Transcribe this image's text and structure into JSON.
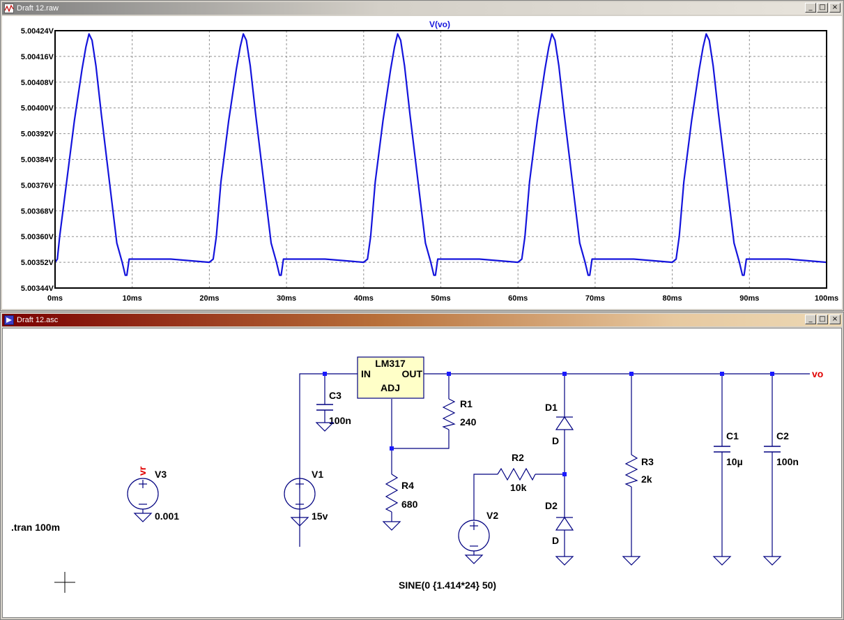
{
  "waveform_window": {
    "title": "Draft 12.raw",
    "buttons": {
      "minimize": "_",
      "maximize": "□",
      "close": "×"
    }
  },
  "schematic_window": {
    "title": "Draft 12.asc",
    "buttons": {
      "minimize": "_",
      "maximize": "□",
      "close": "×"
    }
  },
  "chart_data": {
    "type": "line",
    "title": "V(vo)",
    "xlabel": "",
    "ylabel": "",
    "xlim": [
      0,
      100
    ],
    "ylim": [
      5.00344,
      5.00424
    ],
    "x_ticks": [
      "0ms",
      "10ms",
      "20ms",
      "30ms",
      "40ms",
      "50ms",
      "60ms",
      "70ms",
      "80ms",
      "90ms",
      "100ms"
    ],
    "y_ticks": [
      "5.00424V",
      "5.00416V",
      "5.00408V",
      "5.00400V",
      "5.00392V",
      "5.00384V",
      "5.00376V",
      "5.00368V",
      "5.00360V",
      "5.00352V",
      "5.00344V"
    ],
    "grid": true,
    "series": [
      {
        "name": "V(vo)",
        "color": "#1414dc",
        "x": [
          0,
          0.3,
          0.6,
          1.5,
          2.5,
          3.5,
          4.0,
          4.4,
          4.8,
          5.3,
          6.0,
          7.0,
          8.0,
          8.7,
          9.1,
          9.3,
          9.6,
          10.5,
          15,
          20.0,
          20.5,
          20.9,
          21.5,
          22.5,
          23.5,
          24.0,
          24.4,
          24.8,
          25.3,
          26.0,
          27.0,
          28.0,
          28.7,
          29.1,
          29.3,
          29.6,
          30.5,
          35,
          40.0,
          40.5,
          40.9,
          41.5,
          42.5,
          43.5,
          44.0,
          44.4,
          44.8,
          45.3,
          46.0,
          47.0,
          48.0,
          48.7,
          49.1,
          49.3,
          49.6,
          50.5,
          55,
          60.0,
          60.5,
          60.9,
          61.5,
          62.5,
          63.5,
          64.0,
          64.4,
          64.8,
          65.3,
          66.0,
          67.0,
          68.0,
          68.7,
          69.1,
          69.3,
          69.6,
          70.5,
          75,
          80.0,
          80.5,
          80.9,
          81.5,
          82.5,
          83.5,
          84.0,
          84.4,
          84.8,
          85.3,
          86.0,
          87.0,
          88.0,
          88.7,
          89.1,
          89.3,
          89.6,
          90.5,
          95,
          100
        ],
        "values": [
          5.00352,
          5.00353,
          5.0036,
          5.00377,
          5.00396,
          5.00412,
          5.00419,
          5.00423,
          5.00421,
          5.00413,
          5.00398,
          5.00378,
          5.00358,
          5.00352,
          5.00348,
          5.00348,
          5.00353,
          5.00353,
          5.00353,
          5.00352,
          5.00353,
          5.0036,
          5.00377,
          5.00396,
          5.00412,
          5.00419,
          5.00423,
          5.00421,
          5.00413,
          5.00398,
          5.00378,
          5.00358,
          5.00352,
          5.00348,
          5.00348,
          5.00353,
          5.00353,
          5.00353,
          5.00352,
          5.00353,
          5.0036,
          5.00377,
          5.00396,
          5.00412,
          5.00419,
          5.00423,
          5.00421,
          5.00413,
          5.00398,
          5.00378,
          5.00358,
          5.00352,
          5.00348,
          5.00348,
          5.00353,
          5.00353,
          5.00353,
          5.00352,
          5.00353,
          5.0036,
          5.00377,
          5.00396,
          5.00412,
          5.00419,
          5.00423,
          5.00421,
          5.00413,
          5.00398,
          5.00378,
          5.00358,
          5.00352,
          5.00348,
          5.00348,
          5.00353,
          5.00353,
          5.00353,
          5.00352,
          5.00353,
          5.0036,
          5.00377,
          5.00396,
          5.00412,
          5.00419,
          5.00423,
          5.00421,
          5.00413,
          5.00398,
          5.00378,
          5.00358,
          5.00352,
          5.00348,
          5.00348,
          5.00353,
          5.00353,
          5.00353,
          5.00352
        ]
      }
    ]
  },
  "schematic": {
    "regulator": {
      "name": "LM317",
      "pin_in": "IN",
      "pin_out": "OUT",
      "pin_adj": "ADJ"
    },
    "net_label_vo": "vo",
    "net_label_vr": "vr",
    "V3": {
      "name": "V3",
      "value": "0.001"
    },
    "V1": {
      "name": "V1",
      "value": "15v"
    },
    "V2": {
      "name": "V2",
      "value": "SINE(0 {1.414*24} 50)"
    },
    "C3": {
      "name": "C3",
      "value": "100n"
    },
    "R1": {
      "name": "R1",
      "value": "240"
    },
    "R4": {
      "name": "R4",
      "value": "680"
    },
    "R2": {
      "name": "R2",
      "value": "10k"
    },
    "D1": {
      "name": "D1",
      "value": "D"
    },
    "D2": {
      "name": "D2",
      "value": "D"
    },
    "R3": {
      "name": "R3",
      "value": "2k"
    },
    "C1": {
      "name": "C1",
      "value": "10µ"
    },
    "C2": {
      "name": "C2",
      "value": "100n"
    },
    "directive": ".tran 100m",
    "colors": {
      "wire": "#000080",
      "component": "#000080",
      "junction": "#1a1aff",
      "net_label": "#e00000",
      "regulator_fill": "#ffffc8"
    }
  }
}
